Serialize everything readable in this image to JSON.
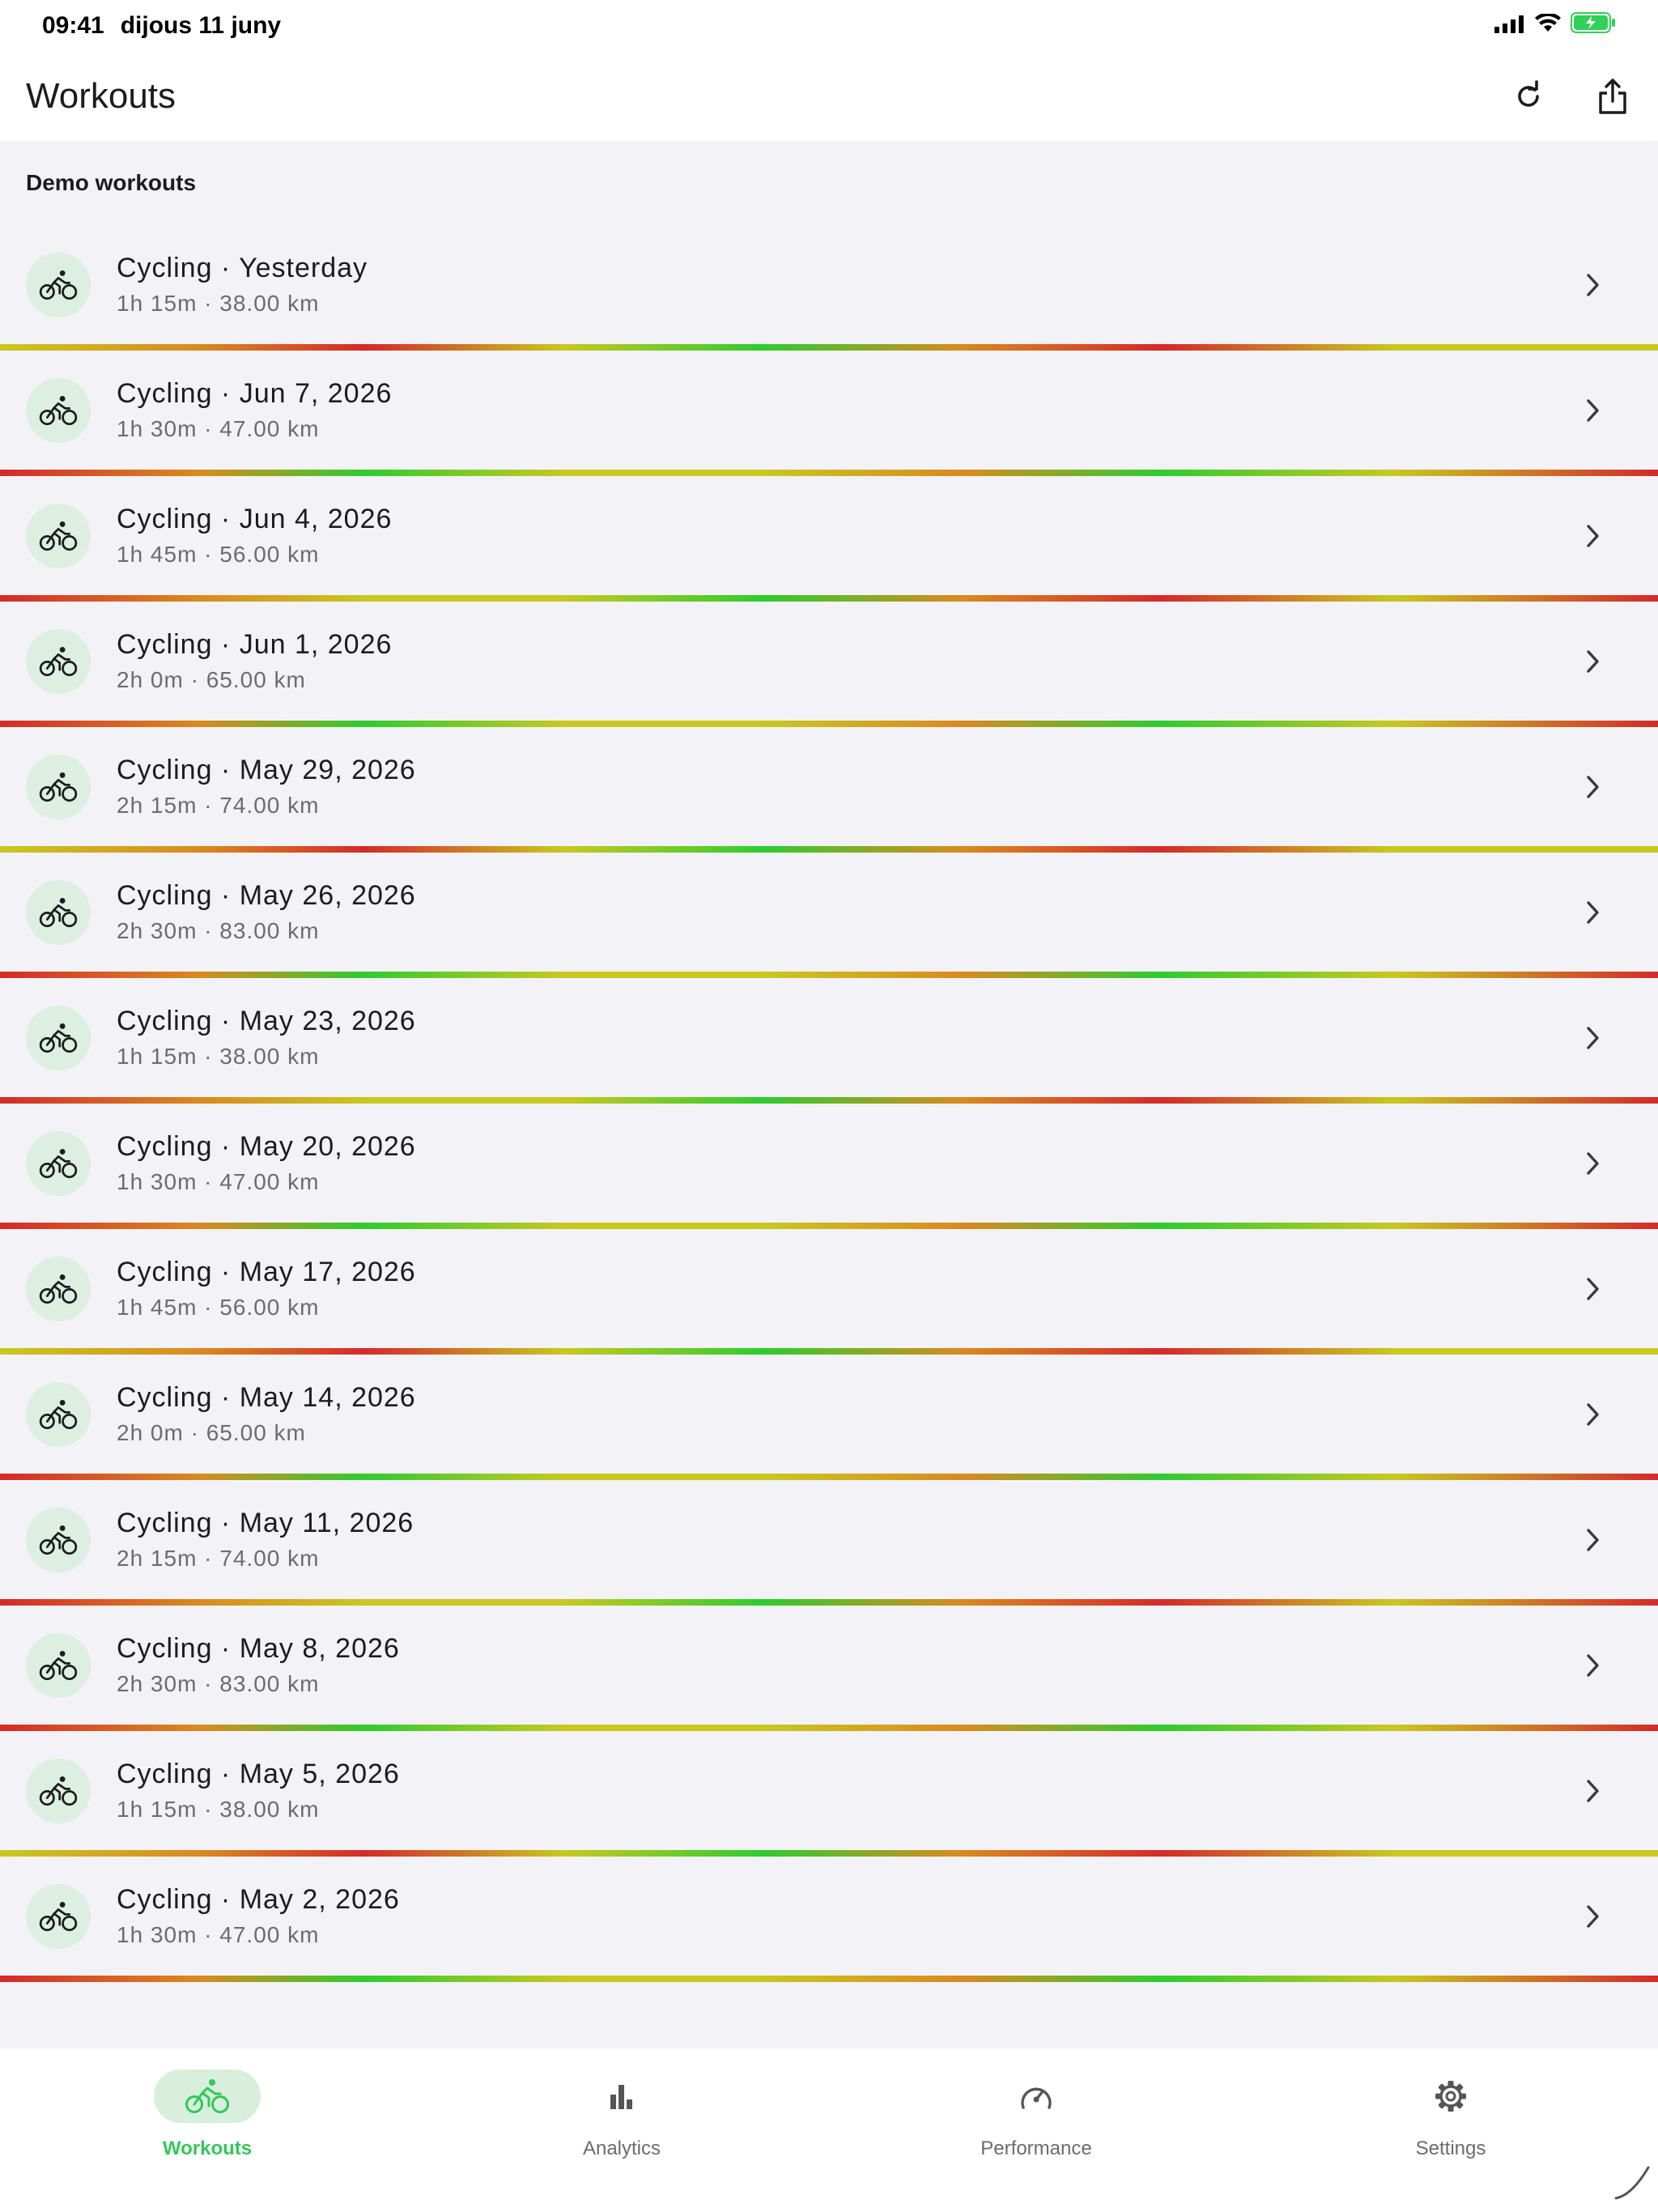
{
  "status": {
    "time": "09:41",
    "date": "dijous 11 juny",
    "battery_color": "#30d158"
  },
  "appbar": {
    "title": "Workouts",
    "refresh_icon": "refresh-icon",
    "share_icon": "share-icon"
  },
  "section": {
    "title": "Demo workouts"
  },
  "workouts": [
    {
      "title": "Cycling · Yesterday",
      "sub": "1h 15m · 38.00 km"
    },
    {
      "title": "Cycling · Jun 7, 2026",
      "sub": "1h 30m · 47.00 km"
    },
    {
      "title": "Cycling · Jun 4, 2026",
      "sub": "1h 45m · 56.00 km"
    },
    {
      "title": "Cycling · Jun 1, 2026",
      "sub": "2h 0m · 65.00 km"
    },
    {
      "title": "Cycling · May 29, 2026",
      "sub": "2h 15m · 74.00 km"
    },
    {
      "title": "Cycling · May 26, 2026",
      "sub": "2h 30m · 83.00 km"
    },
    {
      "title": "Cycling · May 23, 2026",
      "sub": "1h 15m · 38.00 km"
    },
    {
      "title": "Cycling · May 20, 2026",
      "sub": "1h 30m · 47.00 km"
    },
    {
      "title": "Cycling · May 17, 2026",
      "sub": "1h 45m · 56.00 km"
    },
    {
      "title": "Cycling · May 14, 2026",
      "sub": "2h 0m · 65.00 km"
    },
    {
      "title": "Cycling · May 11, 2026",
      "sub": "2h 15m · 74.00 km"
    },
    {
      "title": "Cycling · May 8, 2026",
      "sub": "2h 30m · 83.00 km"
    },
    {
      "title": "Cycling · May 5, 2026",
      "sub": "1h 15m · 38.00 km"
    },
    {
      "title": "Cycling · May 2, 2026",
      "sub": "1h 30m · 47.00 km"
    }
  ],
  "nav": [
    {
      "label": "Workouts",
      "icon": "bike-icon",
      "active": true
    },
    {
      "label": "Analytics",
      "icon": "bar-chart-icon",
      "active": false
    },
    {
      "label": "Performance",
      "icon": "speedometer-icon",
      "active": false
    },
    {
      "label": "Settings",
      "icon": "gear-icon",
      "active": false
    }
  ],
  "colors": {
    "accent": "#34c759",
    "strip_green": "#2ecc2e",
    "strip_yellow": "#c8c820",
    "strip_orange": "#d98a1f",
    "strip_red": "#d42a2a"
  }
}
